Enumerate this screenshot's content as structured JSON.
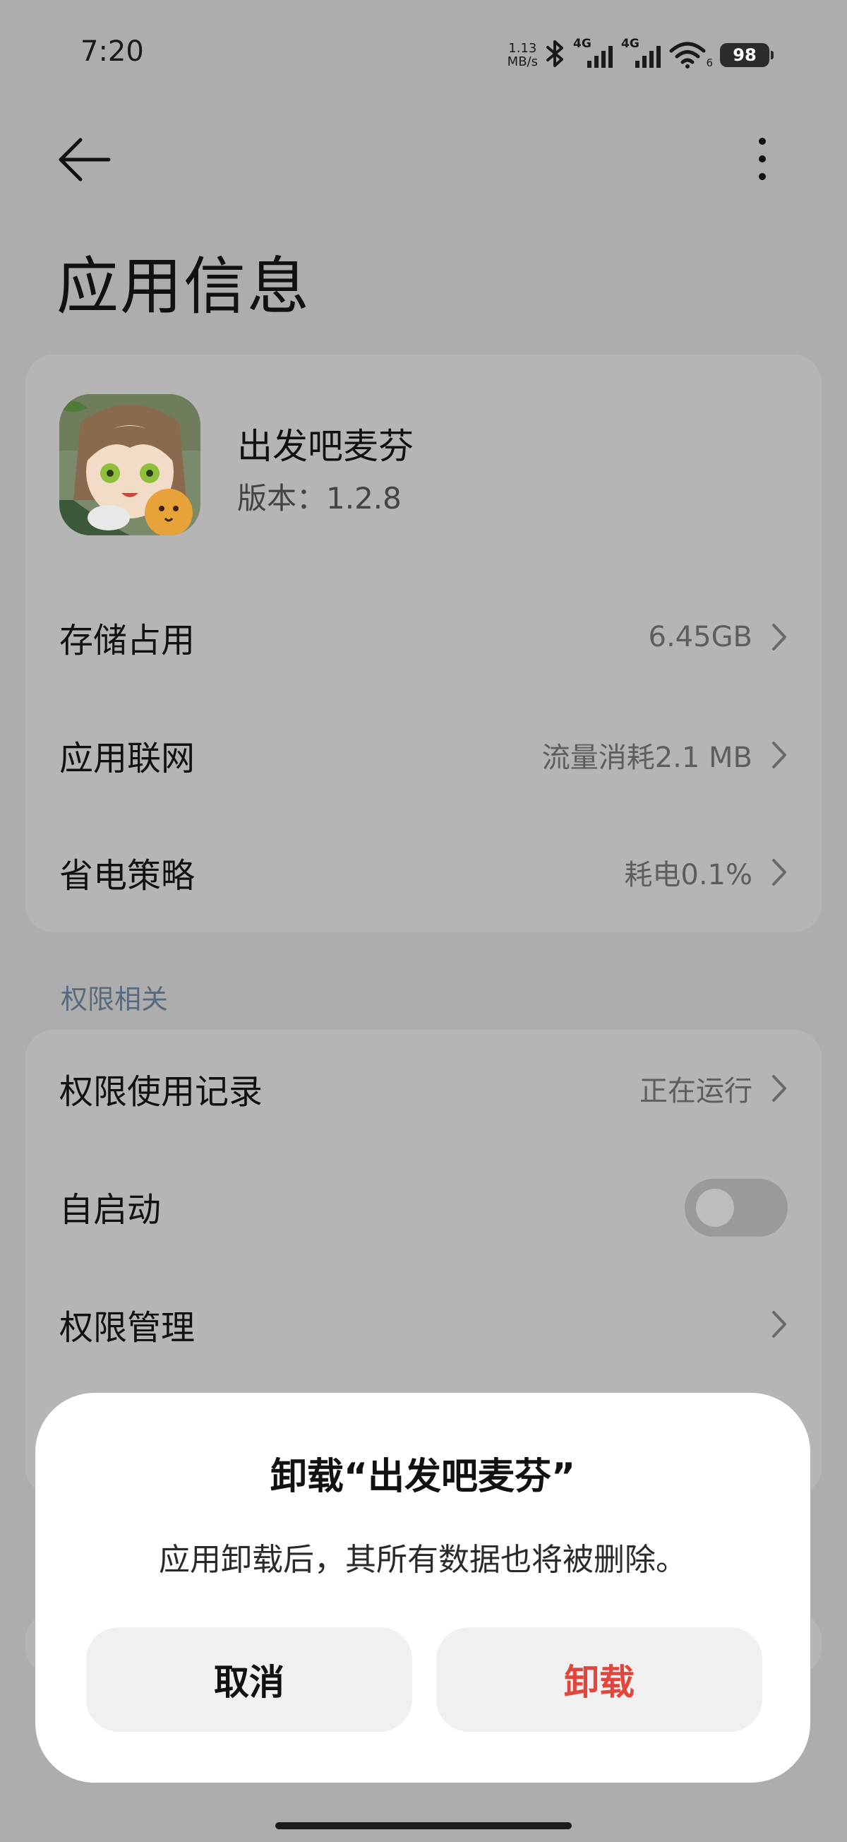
{
  "status_bar": {
    "time": "7:20",
    "speed_value": "1.13",
    "speed_unit": "MB/s",
    "network_1": "4G",
    "network_2": "4G",
    "wifi_index": "6",
    "battery": "98"
  },
  "header": {
    "title": "应用信息"
  },
  "app": {
    "name": "出发吧麦芬",
    "version": "版本：1.2.8"
  },
  "app_rows": [
    {
      "label": "存储占用",
      "value": "6.45GB"
    },
    {
      "label": "应用联网",
      "value": "流量消耗2.1 MB"
    },
    {
      "label": "省电策略",
      "value": "耗电0.1%"
    }
  ],
  "permissions": {
    "section_label": "权限相关",
    "rows": [
      {
        "label": "权限使用记录",
        "value": "正在运行"
      },
      {
        "label": "自启动",
        "toggle": false
      },
      {
        "label": "权限管理"
      }
    ]
  },
  "dialog": {
    "title": "卸载“出发吧麦芬”",
    "message": "应用卸载后，其所有数据也将被删除。",
    "cancel_label": "取消",
    "confirm_label": "卸载",
    "confirm_color": "#e0463c"
  }
}
